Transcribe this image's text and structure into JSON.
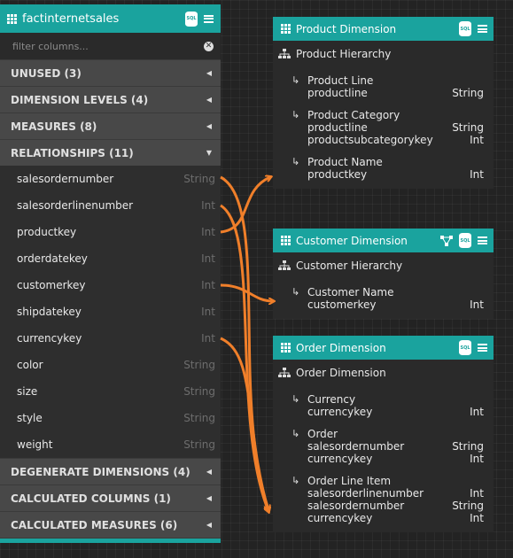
{
  "fact_table": {
    "title": "factinternetsales",
    "filter_placeholder": "filter columns...",
    "sections_top": [
      {
        "label": "UNUSED (3)"
      },
      {
        "label": "DIMENSION LEVELS (4)"
      },
      {
        "label": "MEASURES (8)"
      },
      {
        "label": "RELATIONSHIPS (11)"
      }
    ],
    "fields": [
      {
        "name": "salesordernumber",
        "type": "String"
      },
      {
        "name": "salesorderlinenumber",
        "type": "Int"
      },
      {
        "name": "productkey",
        "type": "Int"
      },
      {
        "name": "orderdatekey",
        "type": "Int"
      },
      {
        "name": "customerkey",
        "type": "Int"
      },
      {
        "name": "shipdatekey",
        "type": "Int"
      },
      {
        "name": "currencykey",
        "type": "Int"
      },
      {
        "name": "color",
        "type": "String"
      },
      {
        "name": "size",
        "type": "String"
      },
      {
        "name": "style",
        "type": "String"
      },
      {
        "name": "weight",
        "type": "String"
      }
    ],
    "sections_bottom": [
      {
        "label": "DEGENERATE DIMENSIONS (4)"
      },
      {
        "label": "CALCULATED COLUMNS (1)"
      },
      {
        "label": "CALCULATED MEASURES (6)"
      }
    ]
  },
  "dimensions": {
    "product": {
      "title": "Product Dimension",
      "hierarchy": "Product Hierarchy",
      "levels": [
        {
          "name": "Product Line",
          "attrs": [
            {
              "name": "productline",
              "type": "String"
            }
          ]
        },
        {
          "name": "Product Category",
          "attrs": [
            {
              "name": "productline",
              "type": "String"
            },
            {
              "name": "productsubcategorykey",
              "type": "Int"
            }
          ]
        },
        {
          "name": "Product Name",
          "attrs": [
            {
              "name": "productkey",
              "type": "Int"
            }
          ]
        }
      ]
    },
    "customer": {
      "title": "Customer Dimension",
      "hierarchy": "Customer Hierarchy",
      "levels": [
        {
          "name": "Customer Name",
          "attrs": [
            {
              "name": "customerkey",
              "type": "Int"
            }
          ]
        }
      ]
    },
    "order": {
      "title": "Order Dimension",
      "hierarchy": "Order Dimension",
      "levels": [
        {
          "name": "Currency",
          "attrs": [
            {
              "name": "currencykey",
              "type": "Int"
            }
          ]
        },
        {
          "name": "Order",
          "attrs": [
            {
              "name": "salesordernumber",
              "type": "String"
            },
            {
              "name": "currencykey",
              "type": "Int"
            }
          ]
        },
        {
          "name": "Order Line Item",
          "attrs": [
            {
              "name": "salesorderlinenumber",
              "type": "Int"
            },
            {
              "name": "salesordernumber",
              "type": "String"
            },
            {
              "name": "currencykey",
              "type": "Int"
            }
          ]
        }
      ]
    }
  },
  "icons": {
    "sql_icon": "SQL",
    "link_color": "#f07f2a",
    "accent_color": "#1aa39e"
  }
}
